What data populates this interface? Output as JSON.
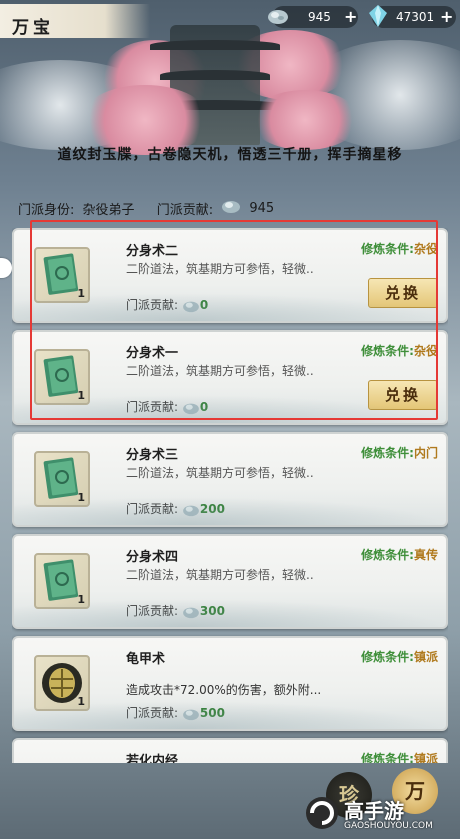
{
  "header": {
    "title": "万宝",
    "currency_1": {
      "icon": "spirit-stone-icon",
      "value": "945"
    },
    "currency_2": {
      "icon": "crystal-icon",
      "value": "47301"
    }
  },
  "slogan": "道纹封玉牒，古卷隐天机，悟透三千册，挥手摘星移",
  "sect": {
    "identity_label": "门派身份:",
    "identity_value": "杂役弟子",
    "contribution_label": "门派贡献:",
    "contribution_value": "945"
  },
  "items": [
    {
      "name": "分身术二",
      "req_label": "修炼条件:",
      "req_value": "杂役",
      "desc": "二阶道法，筑基期方可参悟，轻微..",
      "cost_label": "门派贡献:",
      "cost": "0",
      "count": "1",
      "button": "兑换",
      "icon": "green-book-icon"
    },
    {
      "name": "分身术一",
      "req_label": "修炼条件:",
      "req_value": "杂役",
      "desc": "二阶道法，筑基期方可参悟，轻微..",
      "cost_label": "门派贡献:",
      "cost": "0",
      "count": "1",
      "button": "兑换",
      "icon": "green-book-icon"
    },
    {
      "name": "分身术三",
      "req_label": "修炼条件:",
      "req_value": "内门",
      "desc": "二阶道法，筑基期方可参悟，轻微..",
      "cost_label": "门派贡献:",
      "cost": "200",
      "count": "1",
      "icon": "green-book-icon"
    },
    {
      "name": "分身术四",
      "req_label": "修炼条件:",
      "req_value": "真传",
      "desc": "二阶道法，筑基期方可参悟，轻微..",
      "cost_label": "门派贡献:",
      "cost": "300",
      "count": "1",
      "icon": "green-book-icon"
    },
    {
      "name": "龟甲术",
      "req_label": "修炼条件:",
      "req_value": "镇派",
      "desc": "造成攻击*72.00%的伤害，额外附...",
      "cost_label": "门派贡献:",
      "cost": "500",
      "count": "1",
      "icon": "turtle-shell-icon"
    },
    {
      "name": "若化内经",
      "req_label": "修炼条件:",
      "req_value": "镇派",
      "desc": "",
      "cost_label": "",
      "cost": "",
      "count": "",
      "icon": "green-book-icon"
    }
  ],
  "bottom": {
    "btn_1": "珍",
    "btn_2": "万"
  },
  "watermark": {
    "brand": "高手游",
    "url": "GAOSHOUYOU.COM"
  }
}
